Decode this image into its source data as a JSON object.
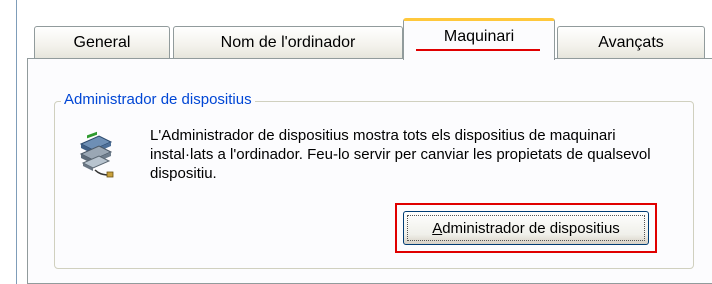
{
  "tabs": [
    {
      "label": "General",
      "active": false
    },
    {
      "label": "Nom de l'ordinador",
      "active": false
    },
    {
      "label": "Maquinari",
      "active": true
    },
    {
      "label": "Avançats",
      "active": false
    }
  ],
  "device_manager": {
    "group_title": "Administrador de dispositius",
    "description": "L'Administrador de dispositius mostra tots els dispositius de maquinari instal·lats a l'ordinador. Feu-lo servir per canviar les propietats de qualsevol dispositiu.",
    "button_mnemonic": "A",
    "button_rest": "dministrador de dispositius",
    "icon": "device-manager-icon"
  },
  "colors": {
    "group_title": "#0046d5",
    "active_tab_top": "#ffc83c",
    "highlight": "#e00000"
  }
}
